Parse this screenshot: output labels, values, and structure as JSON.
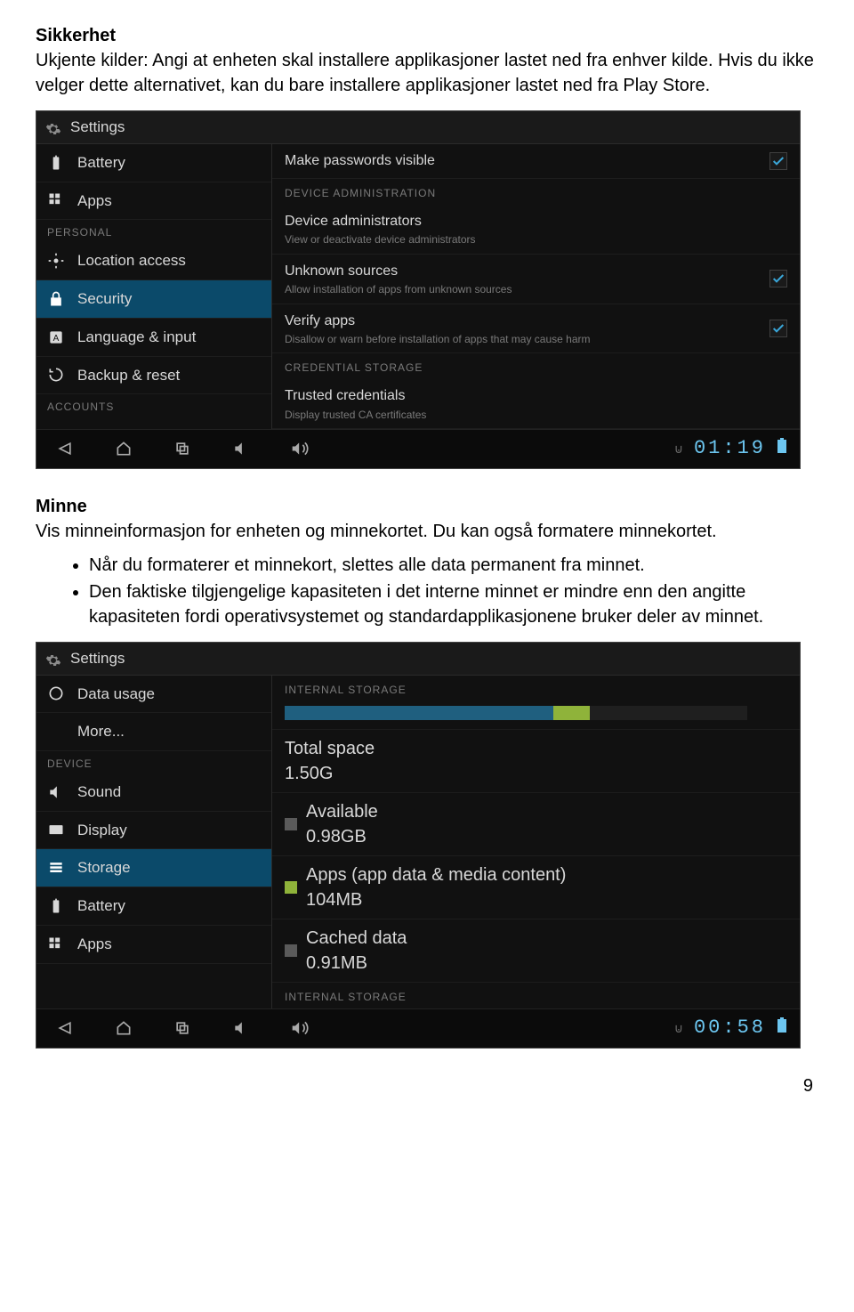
{
  "text": {
    "sec1_title": "Sikkerhet",
    "sec1_body": "Ukjente kilder: Angi at enheten skal installere applikasjoner lastet ned fra enhver kilde. Hvis du ikke velger dette alternativet, kan du bare installere applikasjoner lastet ned fra Play Store.",
    "sec2_title": "Minne",
    "sec2_body": "Vis minneinformasjon for enheten og minnekortet. Du kan også formatere minnekortet.",
    "bullet1": "Når du formaterer et minnekort, slettes alle data permanent fra minnet.",
    "bullet2": "Den faktiske tilgjengelige kapasiteten i det interne minnet er mindre enn den angitte kapasiteten fordi operativsystemet og standardapplikasjonene bruker deler av minnet.",
    "page_number": "9"
  },
  "shot1": {
    "header": "Settings",
    "sidebar": {
      "items": [
        "Battery",
        "Apps",
        "Location access",
        "Security",
        "Language & input",
        "Backup & reset"
      ],
      "personal": "PERSONAL",
      "accounts": "ACCOUNTS"
    },
    "content": {
      "make_passwords": "Make passwords visible",
      "dev_admin_h": "DEVICE ADMINISTRATION",
      "dev_admin_t": "Device administrators",
      "dev_admin_s": "View or deactivate device administrators",
      "unknown_t": "Unknown sources",
      "unknown_s": "Allow installation of apps from unknown sources",
      "verify_t": "Verify apps",
      "verify_s": "Disallow or warn before installation of apps that may cause harm",
      "cred_h": "CREDENTIAL STORAGE",
      "trusted_t": "Trusted credentials",
      "trusted_s": "Display trusted CA certificates"
    },
    "checks": {
      "make_passwords": true,
      "unknown": true,
      "verify": true
    },
    "clock": "01:19"
  },
  "shot2": {
    "header": "Settings",
    "sidebar": {
      "items": [
        "Data usage",
        "More...",
        "Sound",
        "Display",
        "Storage",
        "Battery",
        "Apps"
      ],
      "device": "DEVICE"
    },
    "content": {
      "internal_h": "INTERNAL STORAGE",
      "total_t": "Total space",
      "total_v": "1.50G",
      "avail_t": "Available",
      "avail_v": "0.98GB",
      "apps_t": "Apps (app data & media content)",
      "apps_v": "104MB",
      "cache_t": "Cached data",
      "cache_v": "0.91MB",
      "internal_h2": "INTERNAL STORAGE"
    },
    "bar": {
      "used1": "#1f5f7f",
      "used1w": "58%",
      "used2": "#8fb33a",
      "used2w": "8%"
    },
    "colors": {
      "avail": "#5a5a5a",
      "apps": "#8fb33a",
      "cache": "#5a5a5a"
    },
    "clock": "00:58"
  }
}
